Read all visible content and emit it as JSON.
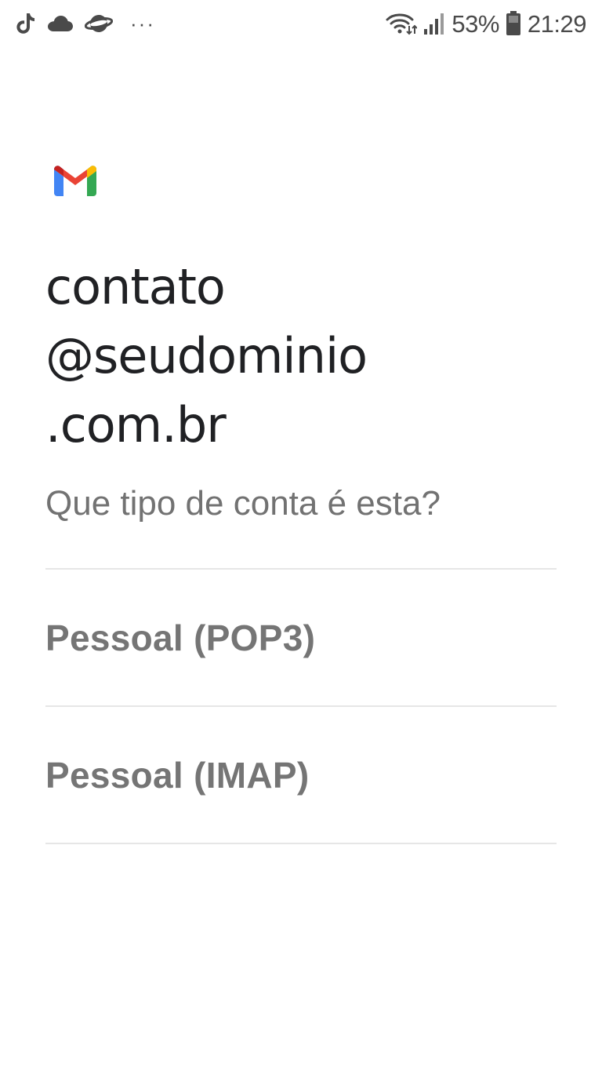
{
  "status_bar": {
    "left_icons": [
      "tiktok-icon",
      "cloud-icon",
      "planet-icon",
      "more-dots-icon"
    ],
    "more_label": "···",
    "battery_percent": "53%",
    "time": "21:29",
    "right_icons": [
      "wifi-icon",
      "signal-icon",
      "battery-icon"
    ]
  },
  "app": {
    "logo_icon": "gmail-logo-icon",
    "colors": {
      "blue": "#4285F4",
      "red": "#EA4335",
      "yellow": "#FBBC04",
      "green": "#34A853"
    }
  },
  "account": {
    "email_lines": [
      "contato",
      "@seudominio",
      ".com.br"
    ]
  },
  "prompt": "Que tipo de conta é esta?",
  "options": [
    {
      "label": "Pessoal (POP3)"
    },
    {
      "label": "Pessoal (IMAP)"
    }
  ]
}
